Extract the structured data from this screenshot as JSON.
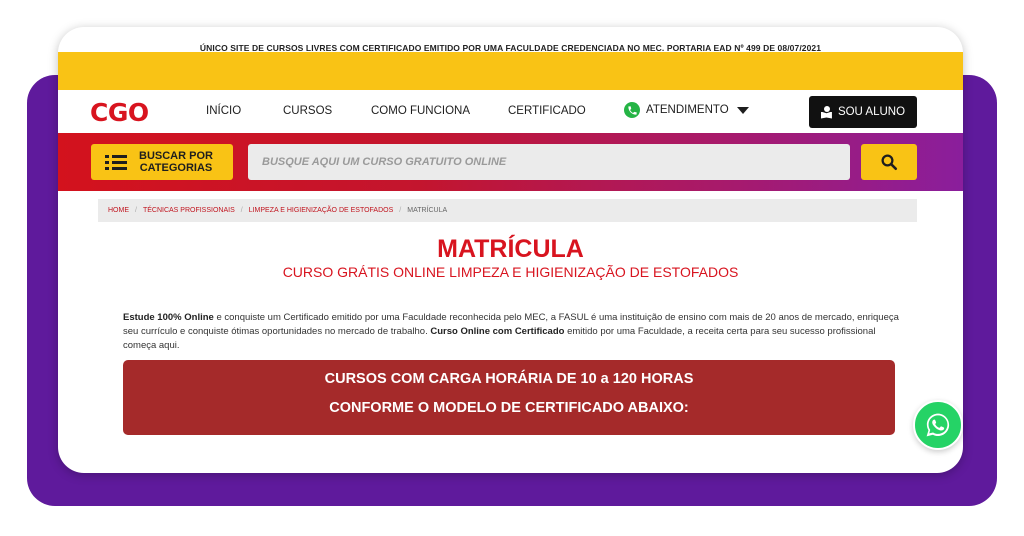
{
  "announcement": "ÚNICO SITE DE CURSOS LIVRES COM CERTIFICADO EMITIDO POR UMA FACULDADE CREDENCIADA NO MEC. PORTARIA EAD Nº 499 DE 08/07/2021",
  "logo": "CGO",
  "nav": {
    "inicio": "INÍCIO",
    "cursos": "CURSOS",
    "como_funciona": "COMO FUNCIONA",
    "certificado": "CERTIFICADO",
    "atendimento": "ATENDIMENTO",
    "sou_aluno": "SOU ALUNO"
  },
  "search": {
    "categories_line1": "BUSCAR POR",
    "categories_line2": "CATEGORIAS",
    "placeholder": "BUSQUE AQUI UM CURSO GRATUITO ONLINE"
  },
  "breadcrumb": {
    "items": [
      "HOME",
      "TÉCNICAS PROFISSIONAIS",
      "LIMPEZA E HIGIENIZAÇÃO DE ESTOFADOS"
    ],
    "current": "MATRÍCULA"
  },
  "page": {
    "title": "MATRÍCULA",
    "subtitle": "CURSO GRÁTIS ONLINE LIMPEZA E HIGIENIZAÇÃO DE ESTOFADOS",
    "body_bold1": "Estude 100% Online",
    "body_text1": " e conquiste um Certificado emitido por uma Faculdade reconhecida pelo MEC, a FASUL é uma instituição de ensino com mais de 20 anos de mercado, enriqueça seu currículo e conquiste ótimas oportunidades no mercado de trabalho. ",
    "body_bold2": "Curso Online com Certificado",
    "body_text2": " emitido por uma Faculdade, a receita certa para seu sucesso profissional começa aqui.",
    "banner_line1": "CURSOS COM CARGA HORÁRIA DE 10 a 120 HORAS",
    "banner_line2": "CONFORME O MODELO DE CERTIFICADO ABAIXO:"
  },
  "colors": {
    "brand_red": "#d8141f",
    "yellow": "#f9c315",
    "purple": "#5f1a9c",
    "banner": "#a52a2a",
    "whatsapp": "#25d366"
  }
}
